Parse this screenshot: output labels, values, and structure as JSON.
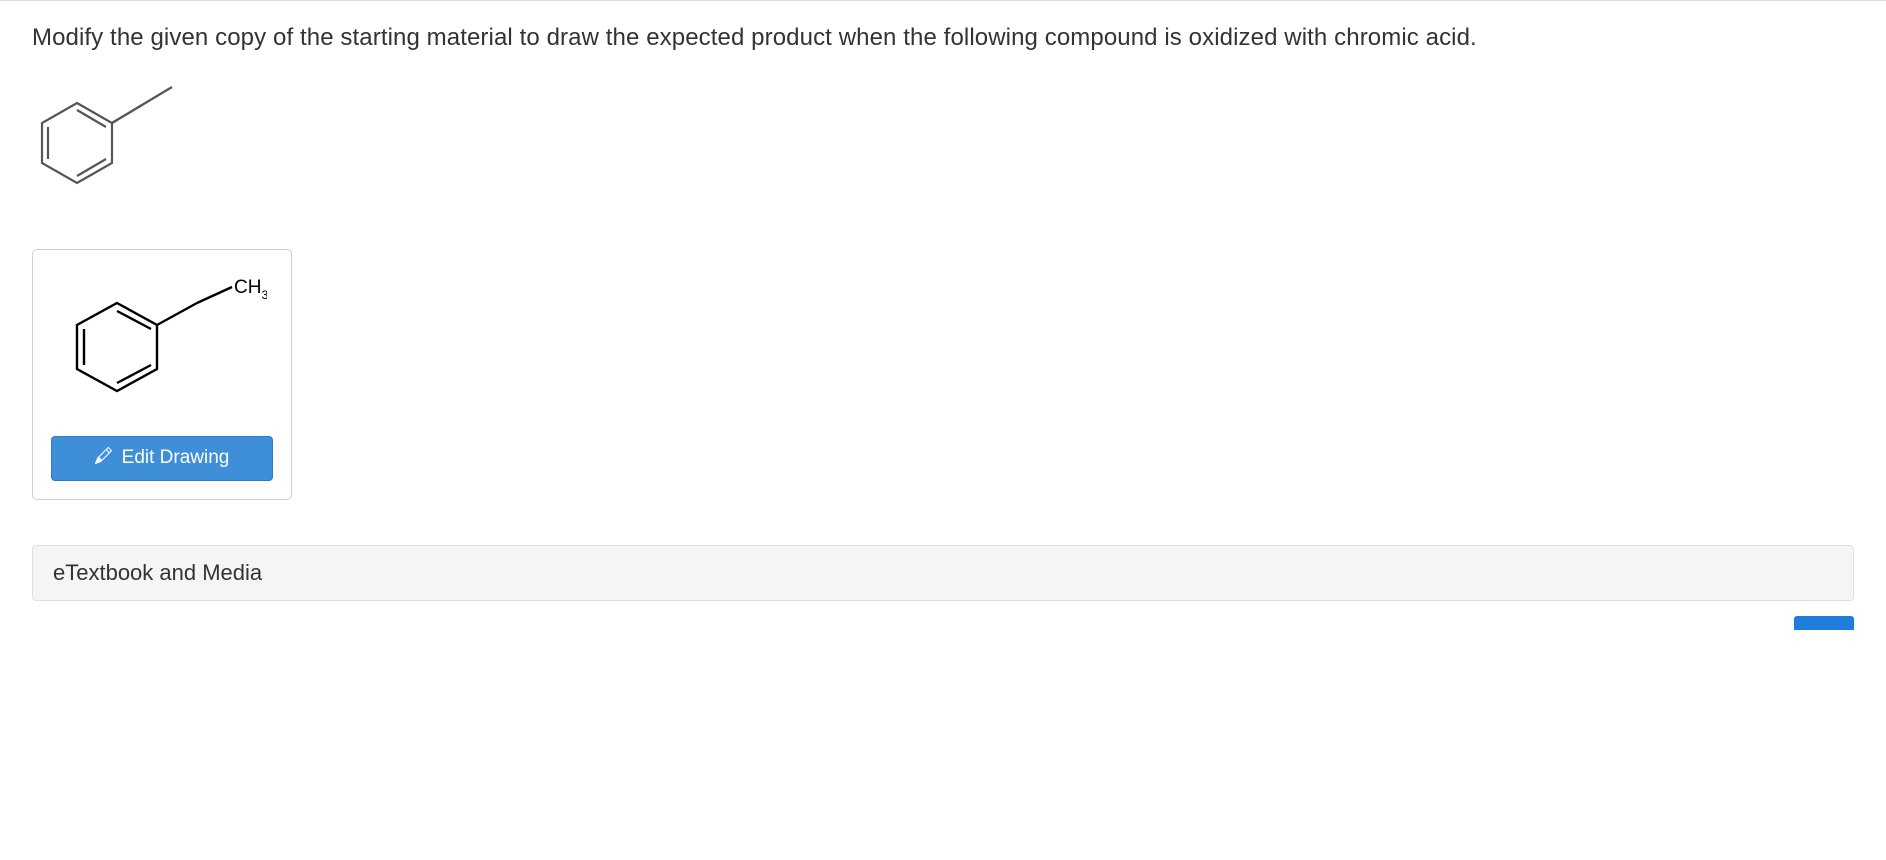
{
  "question": {
    "text": "Modify the given copy of the starting material to draw the expected product when the following compound is oxidized with chromic acid."
  },
  "drawing": {
    "substituent_label": "CH",
    "substituent_sub": "3",
    "edit_button_label": "Edit Drawing"
  },
  "resources": {
    "etextbook_label": "eTextbook and Media"
  }
}
